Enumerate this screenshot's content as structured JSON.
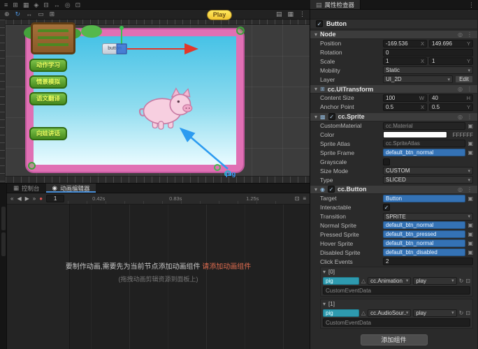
{
  "colors": {
    "accent_blue": "#3472b5",
    "teal_chip": "#2e9aaf",
    "frame_pink": "#e070b4",
    "play_yellow": "#ffe95e",
    "link_orange": "#e06c4f"
  },
  "icons": {
    "caret": "▾",
    "check": "✓",
    "dropdown": "▾",
    "menu_dots": "⋮",
    "help": "◎",
    "asset_picker": "▣",
    "refresh": "↻",
    "box": "⊡",
    "node_triangle": "△",
    "panel": "▤",
    "uitransform_comp": "⊞",
    "sprite_comp": "▩",
    "button_comp": "◉",
    "console_tab": "▦",
    "editor_tab": "◉"
  },
  "topbar": {
    "icons": [
      "≡",
      "⊞",
      "▦",
      "◈",
      "⊟",
      "↔",
      "◎",
      "⊡"
    ],
    "more_icon": "⋮",
    "inspector_tab": "属性检查器"
  },
  "scene": {
    "tools_left": [
      "⊕",
      "↻",
      "↔",
      "▭",
      "⊞"
    ],
    "tools_right": [
      "▤",
      "▦",
      "⋮"
    ],
    "play_label": "Play",
    "menu_buttons": [
      "动作学习",
      "情景模拟",
      "语文翻译",
      "向娃讲话"
    ],
    "button_sprite_label": "button",
    "pig_node_label": "pig"
  },
  "anim": {
    "console_tab": "控制台",
    "editor_tab": "动画编辑器",
    "transport": [
      "«",
      "◀",
      "▶",
      "»"
    ],
    "record_icon": "●",
    "frame_value": "1",
    "time_marks": [
      "0.42s",
      "0.83s",
      "1.25s"
    ],
    "right_icons": [
      "⊡",
      "≡"
    ],
    "message": "要制作动画,需要先为当前节点添加动画组件",
    "message_link": "请添加动画组件",
    "message_hint": "(拖拽动画剪辑资源到面板上)"
  },
  "inspector": {
    "node_name": "Button",
    "axes": {
      "x": "X",
      "y": "Y",
      "w": "W",
      "h": "H"
    },
    "node_section": {
      "title": "Node",
      "position": {
        "label": "Position",
        "x": "-169.536",
        "y": "149.696"
      },
      "rotation": {
        "label": "Rotation",
        "value": "0"
      },
      "scale": {
        "label": "Scale",
        "x": "1",
        "y": "1"
      },
      "mobility": {
        "label": "Mobility",
        "value": "Static"
      },
      "layer": {
        "label": "Layer",
        "value": "UI_2D",
        "edit_label": "Edit"
      }
    },
    "uitransform": {
      "title": "cc.UITransform",
      "content_size": {
        "label": "Content Size",
        "w": "100",
        "h": "40"
      },
      "anchor_point": {
        "label": "Anchor Point",
        "x": "0.5",
        "y": "0.5"
      }
    },
    "sprite": {
      "title": "cc.Sprite",
      "custom_material": {
        "label": "CustomMaterial",
        "placeholder": "cc.Material"
      },
      "color": {
        "label": "Color",
        "hex": "FFFFFF"
      },
      "sprite_atlas": {
        "label": "Sprite Atlas",
        "placeholder": "cc.SpriteAtlas"
      },
      "sprite_frame": {
        "label": "Sprite Frame",
        "value": "default_btn_normal"
      },
      "grayscale_label": "Grayscale",
      "size_mode": {
        "label": "Size Mode",
        "value": "CUSTOM"
      },
      "type": {
        "label": "Type",
        "value": "SLICED"
      }
    },
    "button": {
      "title": "cc.Button",
      "target": {
        "label": "Target",
        "value": "Button"
      },
      "interactable_label": "Interactable",
      "transition": {
        "label": "Transition",
        "value": "SPRITE"
      },
      "normal_sprite": {
        "label": "Normal Sprite",
        "value": "default_btn_normal"
      },
      "pressed_sprite": {
        "label": "Pressed Sprite",
        "value": "default_btn_pressed"
      },
      "hover_sprite": {
        "label": "Hover Sprite",
        "value": "default_btn_normal"
      },
      "disabled_sprite": {
        "label": "Disabled Sprite",
        "value": "default_btn_disabled"
      },
      "click_events": {
        "label": "Click Events",
        "value": "2"
      },
      "events": [
        {
          "index": "[0]",
          "node": "pig",
          "component": "cc.Animation",
          "handler": "play",
          "custom_placeholder": "CustomEventData"
        },
        {
          "index": "[1]",
          "node": "pig",
          "component": "cc.AudioSour...",
          "handler": "play",
          "custom_placeholder": "CustomEventData"
        }
      ]
    },
    "add_component_label": "添加组件"
  }
}
